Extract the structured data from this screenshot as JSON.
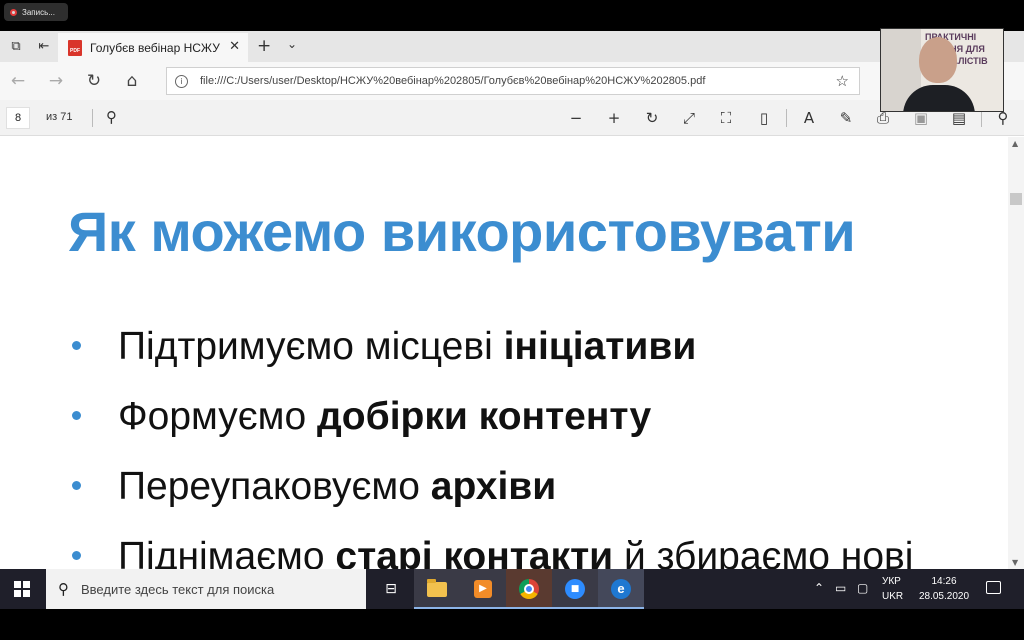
{
  "recording": {
    "label": "Запись..."
  },
  "browser": {
    "tab": {
      "title": "Голубєв вебінар НСЖУ",
      "pdf_icon_text": "PDF"
    },
    "address": {
      "url": "file:///C:/Users/user/Desktop/НСЖУ%20вебінар%202805/Голубєв%20вебінар%20НСЖУ%202805.pdf"
    },
    "pdf_toolbar": {
      "page": "8",
      "total": "из 71"
    }
  },
  "slide": {
    "title": "Як можемо використовувати",
    "bullets": [
      {
        "normal": "Підтримуємо місцеві ",
        "bold": "ініціативи",
        "tail": ""
      },
      {
        "normal": "Формуємо ",
        "bold": "добірки контенту",
        "tail": ""
      },
      {
        "normal": "Переупаковуємо ",
        "bold": "архіви",
        "tail": ""
      },
      {
        "normal": "Піднімаємо ",
        "bold": "старі контакти",
        "tail": " й збираємо нові"
      }
    ]
  },
  "webcam": {
    "banner_text": "ПРАКТИЧНІ\nЗНАННЯ ДЛЯ\nЖУРНАЛІСТІВ"
  },
  "taskbar": {
    "search_placeholder": "Введите здесь текст для поиска",
    "lang_top": "УКР",
    "lang_bottom": "UKR",
    "time": "14:26",
    "date": "28.05.2020"
  },
  "colors": {
    "accent": "#3c8dd0",
    "taskbar": "#1f1f2a"
  }
}
